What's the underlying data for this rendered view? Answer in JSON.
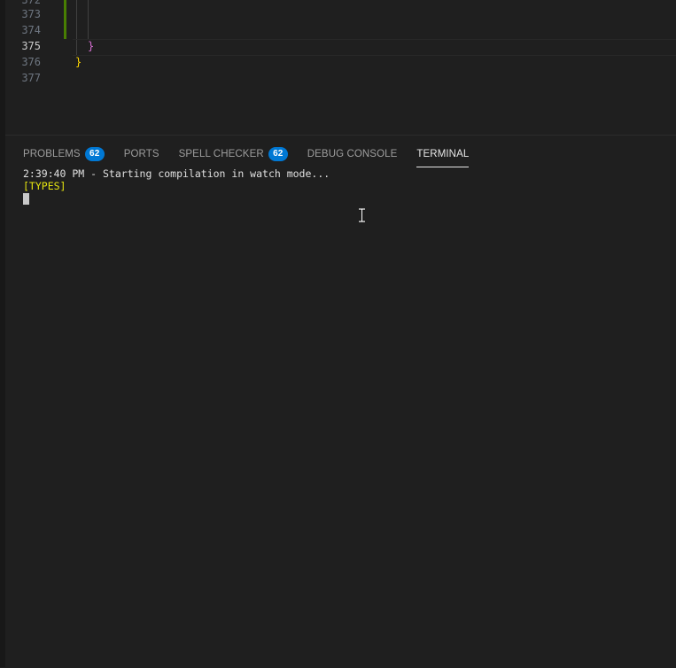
{
  "editor": {
    "lines": [
      {
        "number": "372",
        "code": ""
      },
      {
        "number": "373",
        "code": ""
      },
      {
        "number": "374",
        "code": ""
      },
      {
        "number": "375",
        "code": "}"
      },
      {
        "number": "376",
        "code": "}"
      },
      {
        "number": "377",
        "code": ""
      }
    ],
    "active_line": "375"
  },
  "panel": {
    "tabs": [
      {
        "label": "PROBLEMS",
        "badge": "62"
      },
      {
        "label": "PORTS"
      },
      {
        "label": "SPELL CHECKER",
        "badge": "62"
      },
      {
        "label": "DEBUG CONSOLE"
      },
      {
        "label": "TERMINAL",
        "active": true
      }
    ]
  },
  "terminal": {
    "line1": "2:39:40 PM - Starting compilation in watch mode...",
    "line2": "[TYPES]"
  },
  "colors": {
    "accent": "#0078d4",
    "git_modified": "#487e02",
    "types_label": "#e5e510"
  }
}
